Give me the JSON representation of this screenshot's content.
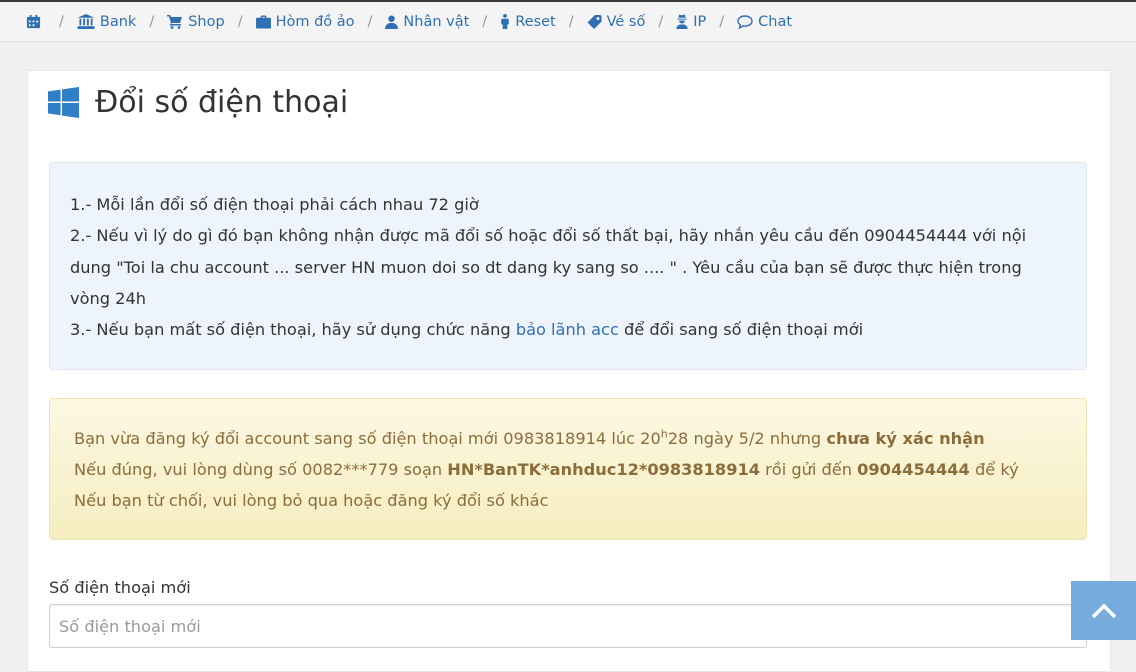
{
  "nav": {
    "items": [
      {
        "label": "",
        "icon": "calendar-icon"
      },
      {
        "label": "Bank",
        "icon": "bank-icon"
      },
      {
        "label": "Shop",
        "icon": "cart-icon"
      },
      {
        "label": "Hòm đồ ảo",
        "icon": "briefcase-icon"
      },
      {
        "label": "Nhân vật",
        "icon": "user-icon"
      },
      {
        "label": "Reset",
        "icon": "male-icon"
      },
      {
        "label": "Vé số",
        "icon": "ticket-icon"
      },
      {
        "label": "IP",
        "icon": "user-secret-icon"
      },
      {
        "label": "Chat",
        "icon": "comment-icon"
      }
    ],
    "separator": "/"
  },
  "page": {
    "title": "Đổi số điện thoại"
  },
  "info": {
    "line1": "1.- Mỗi lần đổi số điện thoại phải cách nhau 72 giờ",
    "line2": "2.- Nếu vì lý do gì đó bạn không nhận được mã đổi số hoặc đổi số thất bại, hãy nhắn yêu cầu đến 0904454444 với nội dung \"Toi la chu account ... server HN muon doi so dt dang ky sang so .... \" . Yêu cầu của bạn sẽ được thực hiện trong vòng 24h",
    "line3_before": "3.- Nếu bạn mất số điện thoại, hãy sử dụng chức năng ",
    "line3_link": "bảo lãnh acc",
    "line3_after": " để đổi sang số điện thoại mới"
  },
  "notice": {
    "l1_a": "Bạn vừa đăng ký đổi account sang số điện thoại mới 0983818914 lúc 20",
    "l1_sup": "h",
    "l1_b": "28 ngày 5/2 nhưng ",
    "l1_bold": "chưa ký xác nhận",
    "l2_a": "Nếu đúng, vui lòng dùng số 0082***779 soạn ",
    "l2_bold1": "HN*BanTK*anhduc12*0983818914",
    "l2_b": " rồi gửi đến ",
    "l2_bold2": "0904454444",
    "l2_c": " để ký",
    "l3": "Nếu bạn từ chối, vui lòng bỏ qua hoặc đăng ký đổi số khác"
  },
  "form": {
    "label": "Số điện thoại mới",
    "placeholder": "Số điện thoại mới",
    "value": ""
  },
  "colors": {
    "link": "#2f6fb3",
    "notice_text": "#8a6d3b",
    "scroll_button": "#6fa8dc"
  }
}
